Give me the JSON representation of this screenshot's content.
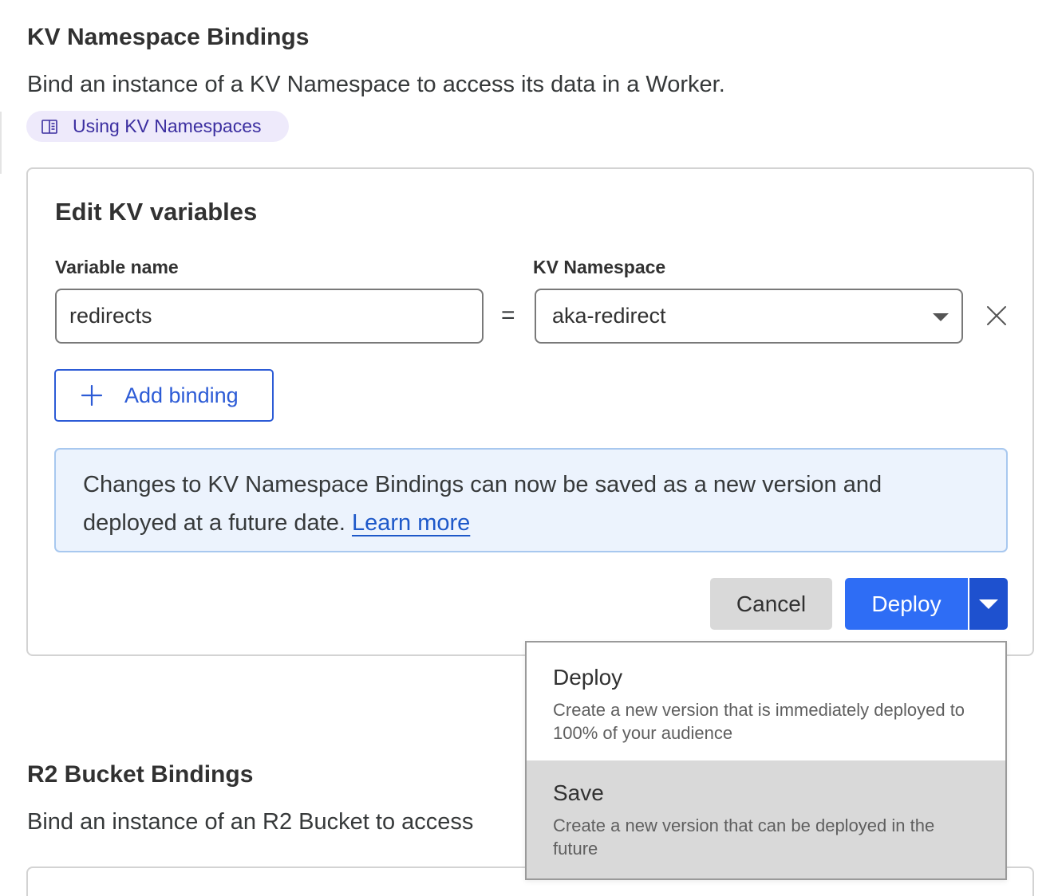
{
  "kv": {
    "title": "KV Namespace Bindings",
    "description": "Bind an instance of a KV Namespace to access its data in a Worker.",
    "doc_link": "Using KV Namespaces",
    "card": {
      "title": "Edit KV variables",
      "variable_label": "Variable name",
      "namespace_label": "KV Namespace",
      "variable_value": "redirects",
      "equals": "=",
      "namespace_value": "aka-redirect",
      "add_binding": "Add binding",
      "info_text": "Changes to KV Namespace Bindings can now be saved as a new version and deployed at a future date.",
      "info_link": "Learn more",
      "cancel": "Cancel",
      "deploy": "Deploy"
    }
  },
  "deploy_menu": {
    "items": [
      {
        "title": "Deploy",
        "description": "Create a new version that is immediately deployed to 100% of your audience"
      },
      {
        "title": "Save",
        "description": "Create a new version that can be deployed in the future"
      }
    ]
  },
  "r2": {
    "title": "R2 Bucket Bindings",
    "description": "Bind an instance of an R2 Bucket to access"
  },
  "icons": {
    "doc": "book-icon",
    "remove": "close-icon",
    "add": "plus-icon",
    "select": "chevron-down-icon",
    "split": "caret-down-icon"
  },
  "colors": {
    "primary": "#2e6df5",
    "primary_dark": "#1e51cf",
    "link": "#1d58c9",
    "pill_bg": "#eeeafb",
    "pill_text": "#3b2ea0",
    "info_bg": "#ecf3fd",
    "info_border": "#a8c8ef"
  }
}
